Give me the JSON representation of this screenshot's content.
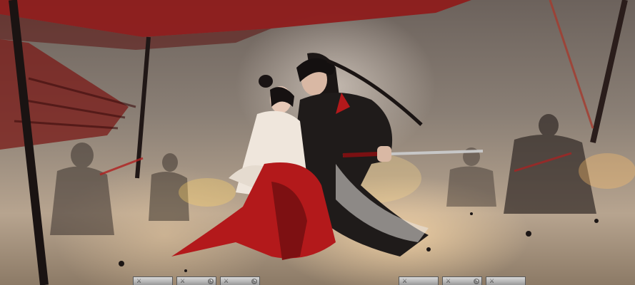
{
  "scene": {
    "description_hidden": "",
    "colors": {
      "banner": "#9b1b1b",
      "blade": "#c7c7c7",
      "robe_red": "#b3191b",
      "robe_white": "#efe6dc",
      "robe_black": "#1f1b1a"
    }
  },
  "skill_bar": {
    "slots": [
      {
        "icon": "sword-icon",
        "glyph": "⚔",
        "key": ""
      },
      {
        "icon": "sword-icon",
        "glyph": "⚔",
        "key": "◔"
      },
      {
        "icon": "sword-icon",
        "glyph": "⚔",
        "key": "◔"
      },
      {
        "icon": "sword-icon",
        "glyph": "⚔",
        "key": ""
      },
      {
        "icon": "sword-icon",
        "glyph": "⚔",
        "key": "◔"
      },
      {
        "icon": "sword-icon",
        "glyph": "⚔",
        "key": ""
      }
    ]
  }
}
